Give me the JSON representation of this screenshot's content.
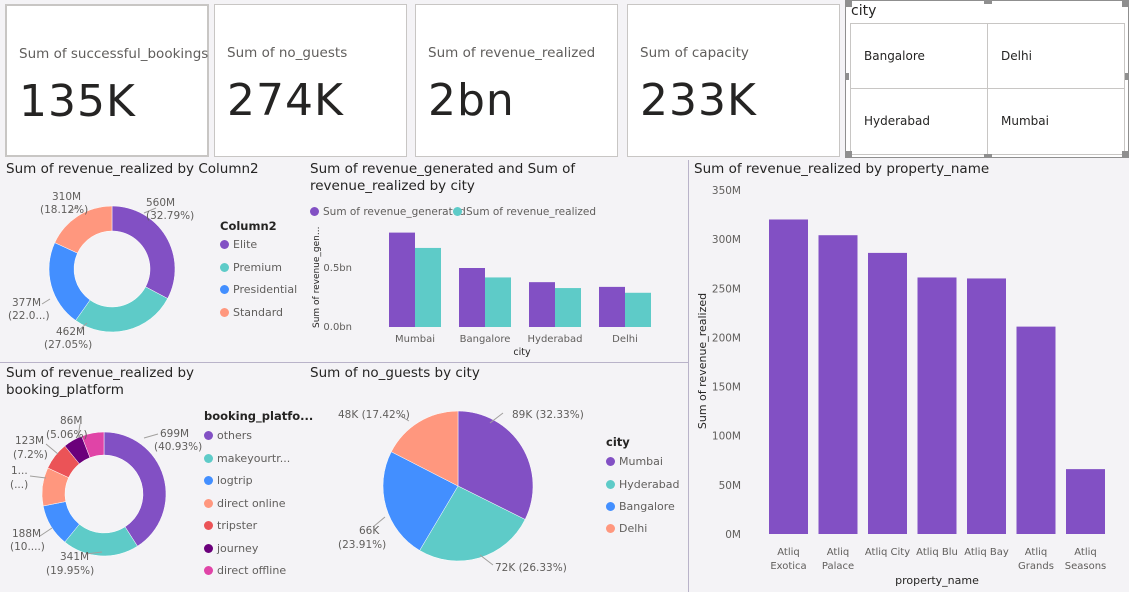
{
  "colors": {
    "purple": "#8250c4",
    "teal": "#5ecbc8",
    "blue": "#438fff",
    "salmon": "#ff977e",
    "red": "#eb5357",
    "darkpurple": "#6b007b",
    "pink": "#e044a7"
  },
  "cards": [
    {
      "title": "Sum of successful_bookings",
      "value": "135K"
    },
    {
      "title": "Sum of no_guests",
      "value": "274K"
    },
    {
      "title": "Sum of revenue_realized",
      "value": "2bn"
    },
    {
      "title": "Sum of capacity",
      "value": "233K"
    }
  ],
  "slicer": {
    "title": "city",
    "items": [
      "Bangalore",
      "Delhi",
      "Hyderabad",
      "Mumbai"
    ]
  },
  "visuals": {
    "donut_class": {
      "title": "Sum of revenue_realized by Column2",
      "legend_title": "Column2",
      "legend": [
        "Elite",
        "Premium",
        "Presidential",
        "Standard"
      ],
      "labels": [
        {
          "line1": "560M",
          "line2": "(32.79%)"
        },
        {
          "line1": "462M",
          "line2": "(27.05%)"
        },
        {
          "line1": "377M",
          "line2": "(22.0...)"
        },
        {
          "line1": "310M",
          "line2": "(18.12%)"
        }
      ]
    },
    "city_bars": {
      "title_line1": "Sum of revenue_generated and Sum of",
      "title_line2": "revenue_realized by city",
      "legend": [
        "Sum of revenue_generated",
        "Sum of revenue_realized"
      ],
      "ylabel": "Sum of revenue_gen...",
      "xlabel": "city",
      "yticks": [
        "0.5bn",
        "0.0bn"
      ]
    },
    "donut_platform": {
      "title_line1": "Sum of revenue_realized by",
      "title_line2": "booking_platform",
      "legend_title": "booking_platfo...",
      "legend": [
        "others",
        "makeyourtr...",
        "logtrip",
        "direct online",
        "tripster",
        "journey",
        "direct offline"
      ],
      "labels": [
        {
          "line1": "699M",
          "line2": "(40.93%)"
        },
        {
          "line1": "341M",
          "line2": "(19.95%)"
        },
        {
          "line1": "188M",
          "line2": "(10....)"
        },
        {
          "line1": "1...",
          "line2": "(...)"
        },
        {
          "line1": "123M",
          "line2": "(7.2%)"
        },
        {
          "line1": "86M",
          "line2": "(5.06%)"
        }
      ]
    },
    "pie_guests": {
      "title": "Sum of no_guests by city",
      "legend_title": "city",
      "legend": [
        "Mumbai",
        "Hyderabad",
        "Bangalore",
        "Delhi"
      ],
      "labels": [
        {
          "line1": "89K (32.33%)",
          "line2": ""
        },
        {
          "line1": "72K (26.33%)",
          "line2": ""
        },
        {
          "line1": "66K",
          "line2": "(23.91%)"
        },
        {
          "line1": "48K (17.42%)",
          "line2": ""
        }
      ]
    },
    "property_bars": {
      "title": "Sum of revenue_realized by property_name",
      "ylabel": "Sum of revenue_realized",
      "xlabel": "property_name",
      "yticks": [
        "350M",
        "300M",
        "250M",
        "200M",
        "150M",
        "100M",
        "50M",
        "0M"
      ]
    }
  },
  "chart_data": [
    {
      "type": "pie",
      "title": "Sum of revenue_realized by Column2",
      "categories": [
        "Elite",
        "Premium",
        "Presidential",
        "Standard"
      ],
      "values": [
        560,
        462,
        377,
        310
      ],
      "percents": [
        32.79,
        27.05,
        22.04,
        18.12
      ],
      "unit": "M",
      "legend": "right"
    },
    {
      "type": "bar",
      "title": "Sum of revenue_generated and Sum of revenue_realized by city",
      "categories": [
        "Mumbai",
        "Bangalore",
        "Hyderabad",
        "Delhi"
      ],
      "series": [
        {
          "name": "Sum of revenue_generated",
          "values": [
            0.8,
            0.5,
            0.38,
            0.34
          ]
        },
        {
          "name": "Sum of revenue_realized",
          "values": [
            0.67,
            0.42,
            0.33,
            0.29
          ]
        }
      ],
      "xlabel": "city",
      "ylabel": "Sum of revenue_gen...",
      "ylim": [
        0,
        0.9
      ],
      "unit": "bn",
      "legend": "top-left"
    },
    {
      "type": "pie",
      "title": "Sum of revenue_realized by booking_platform",
      "categories": [
        "others",
        "makeyourtr...",
        "logtrip",
        "direct online",
        "tripster",
        "journey",
        "direct offline"
      ],
      "values": [
        699,
        341,
        188,
        171,
        123,
        86,
        100
      ],
      "percents": [
        40.93,
        19.95,
        11.0,
        10.0,
        7.2,
        5.06,
        5.86
      ],
      "unit": "M",
      "legend": "right"
    },
    {
      "type": "pie",
      "title": "Sum of no_guests by city",
      "categories": [
        "Mumbai",
        "Hyderabad",
        "Bangalore",
        "Delhi"
      ],
      "values": [
        89,
        72,
        66,
        48
      ],
      "percents": [
        32.33,
        26.33,
        23.91,
        17.42
      ],
      "unit": "K",
      "legend": "right"
    },
    {
      "type": "bar",
      "title": "Sum of revenue_realized by property_name",
      "categories": [
        "Atliq Exotica",
        "Atliq Palace",
        "Atliq City",
        "Atliq Blu",
        "Atliq Bay",
        "Atliq Grands",
        "Atliq Seasons"
      ],
      "category_lines": [
        [
          "Atliq",
          "Exotica"
        ],
        [
          "Atliq",
          "Palace"
        ],
        [
          "Atliq City"
        ],
        [
          "Atliq Blu"
        ],
        [
          "Atliq Bay"
        ],
        [
          "Atliq",
          "Grands"
        ],
        [
          "Atliq",
          "Seasons"
        ]
      ],
      "values": [
        320,
        304,
        286,
        261,
        260,
        211,
        66
      ],
      "unit": "M",
      "xlabel": "property_name",
      "ylabel": "Sum of revenue_realized",
      "ylim": [
        0,
        350
      ]
    }
  ]
}
